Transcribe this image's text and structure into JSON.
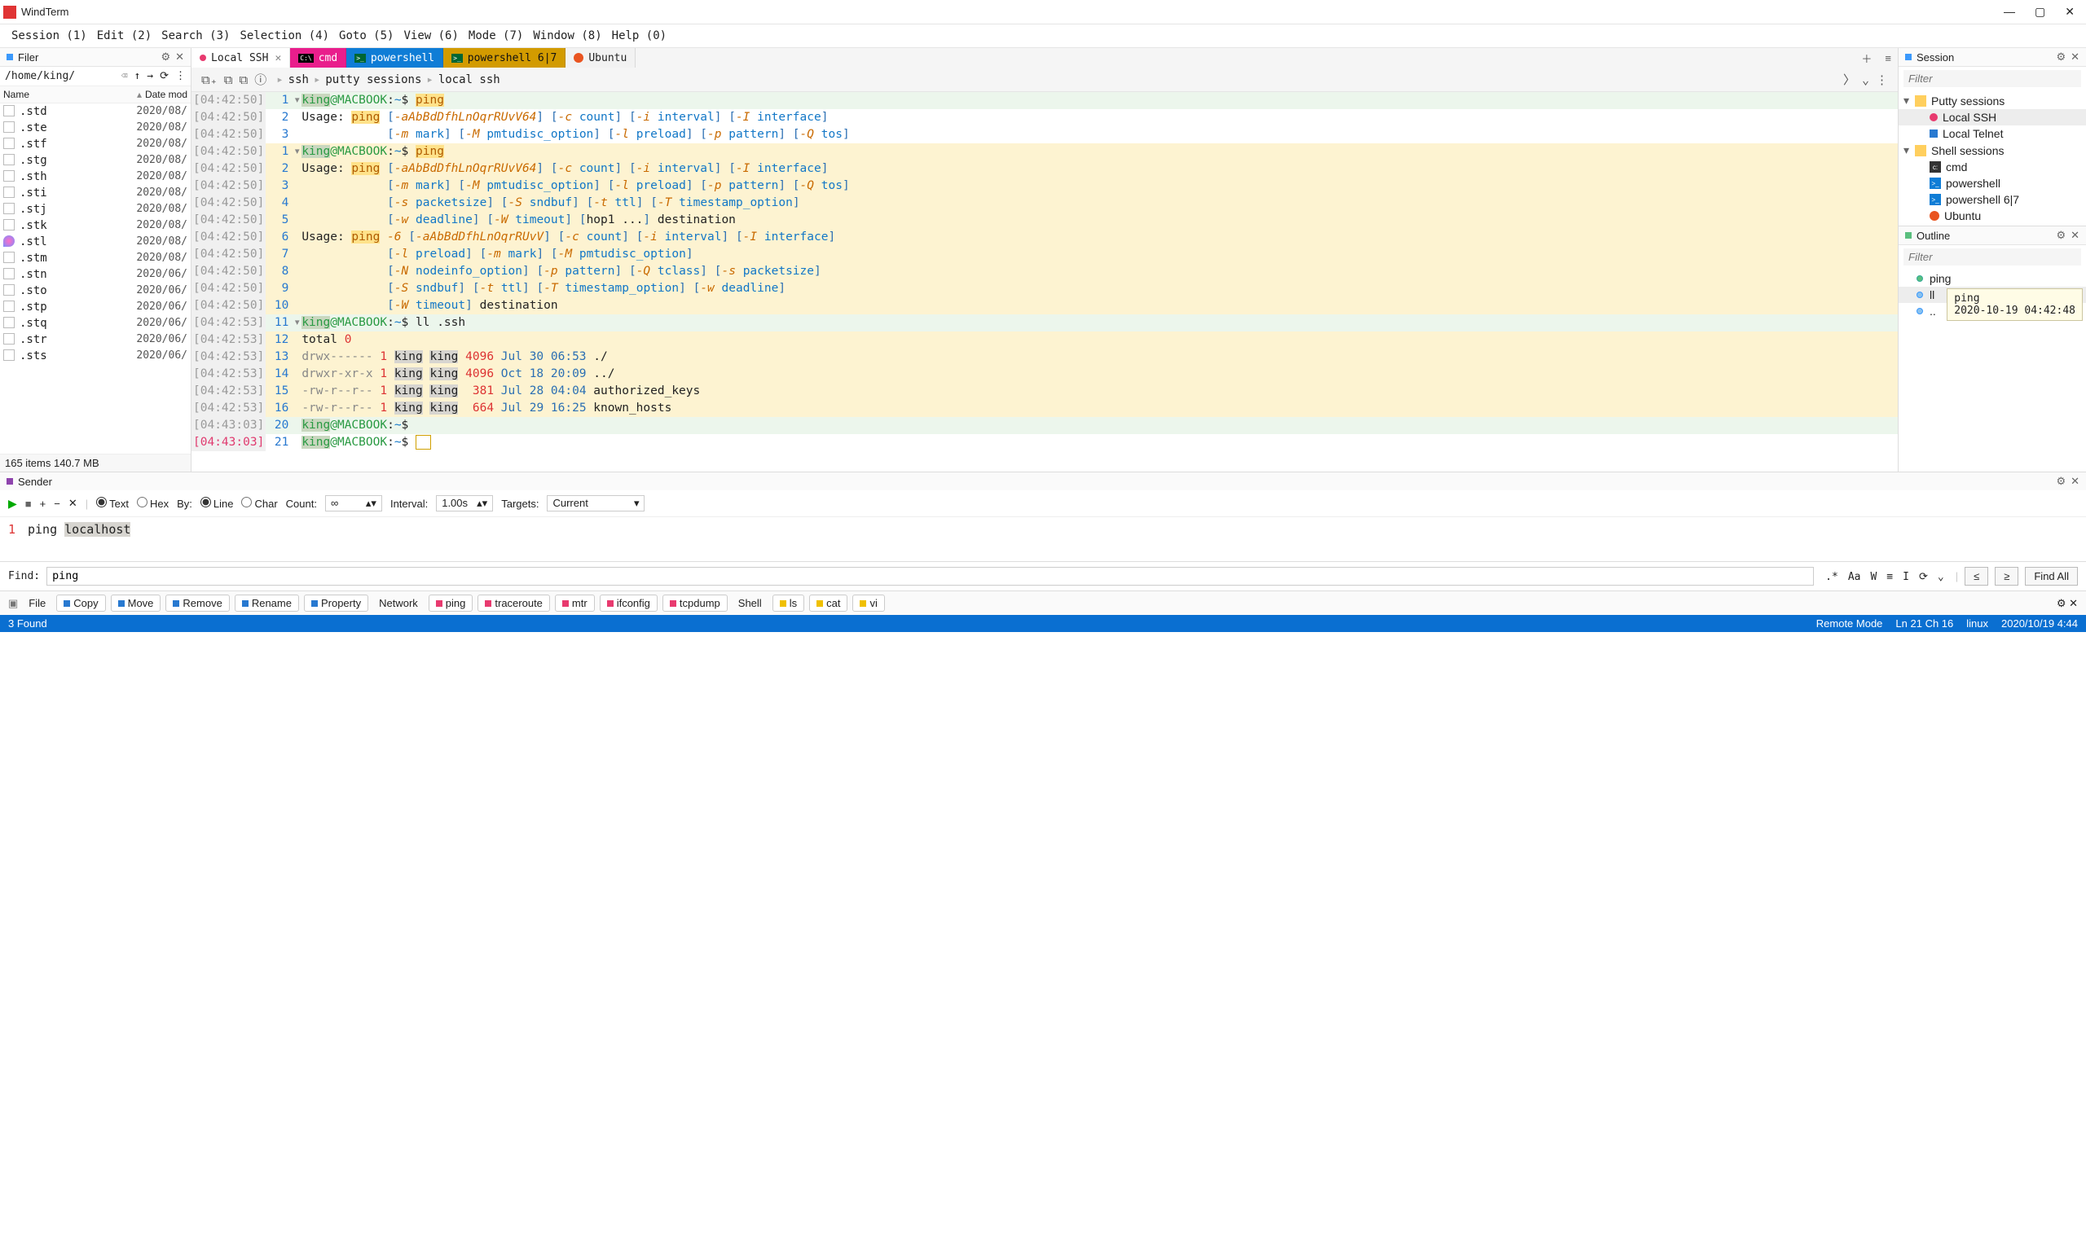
{
  "title": "WindTerm",
  "menu": [
    "Session (1)",
    "Edit (2)",
    "Search (3)",
    "Selection (4)",
    "Goto (5)",
    "View (6)",
    "Mode (7)",
    "Window (8)",
    "Help (0)"
  ],
  "filer": {
    "title": "Filer",
    "path": "/home/king/",
    "cols": [
      "Name",
      "Date mod"
    ],
    "items": [
      {
        "name": ".std",
        "date": "2020/08/"
      },
      {
        "name": ".ste",
        "date": "2020/08/"
      },
      {
        "name": ".stf",
        "date": "2020/08/"
      },
      {
        "name": ".stg",
        "date": "2020/08/"
      },
      {
        "name": ".sth",
        "date": "2020/08/"
      },
      {
        "name": ".sti",
        "date": "2020/08/"
      },
      {
        "name": ".stj",
        "date": "2020/08/"
      },
      {
        "name": ".stk",
        "date": "2020/08/"
      },
      {
        "name": ".stl",
        "date": "2020/08/",
        "balloon": true
      },
      {
        "name": ".stm",
        "date": "2020/08/"
      },
      {
        "name": ".stn",
        "date": "2020/06/"
      },
      {
        "name": ".sto",
        "date": "2020/06/"
      },
      {
        "name": ".stp",
        "date": "2020/06/"
      },
      {
        "name": ".stq",
        "date": "2020/06/"
      },
      {
        "name": ".str",
        "date": "2020/06/"
      },
      {
        "name": ".sts",
        "date": "2020/06/"
      }
    ],
    "footer": "165 items 140.7 MB"
  },
  "tabs": [
    {
      "label": "Local SSH",
      "cls": "local",
      "dot": "#e83a6f",
      "close": true
    },
    {
      "label": "cmd",
      "cls": "cmd",
      "icon": "cmd"
    },
    {
      "label": "powershell",
      "cls": "ps1",
      "icon": "ps"
    },
    {
      "label": "powershell 6|7",
      "cls": "ps2",
      "icon": "ps"
    },
    {
      "label": "Ubuntu",
      "cls": "ubu",
      "icon": "ubu"
    }
  ],
  "breadcrumb": [
    "ssh",
    "putty sessions",
    "local ssh"
  ],
  "session": {
    "title": "Session",
    "filter": "Filter",
    "groups": [
      {
        "label": "Putty sessions",
        "items": [
          {
            "label": "Local SSH",
            "ico": "red",
            "selected": true
          },
          {
            "label": "Local Telnet",
            "ico": "blue"
          }
        ]
      },
      {
        "label": "Shell sessions",
        "items": [
          {
            "label": "cmd",
            "ico": "cmd"
          },
          {
            "label": "powershell",
            "ico": "ps"
          },
          {
            "label": "powershell 6|7",
            "ico": "ps"
          },
          {
            "label": "Ubuntu",
            "ico": "ubu"
          }
        ]
      }
    ]
  },
  "outline": {
    "title": "Outline",
    "filter": "Filter",
    "items": [
      {
        "label": "ping",
        "cls": "green"
      },
      {
        "label": "ll",
        "cls": "blue",
        "sel": true
      },
      {
        "label": "..",
        "cls": "blue"
      }
    ],
    "tooltip": {
      "l1": "ping",
      "l2": "2020-10-19 04:42:48"
    }
  },
  "sender": {
    "title": "Sender",
    "textLabel": "Text",
    "hexLabel": "Hex",
    "byLabel": "By:",
    "lineLabel": "Line",
    "charLabel": "Char",
    "countLabel": "Count:",
    "countVal": "∞",
    "intervalLabel": "Interval:",
    "intervalVal": "1.00s",
    "targetsLabel": "Targets:",
    "targetsVal": "Current",
    "line_no": "1",
    "cmd_pre": "ping ",
    "cmd_sel": "localhost"
  },
  "find": {
    "label": "Find:",
    "value": "ping",
    "opts": [
      ".*",
      "Aa",
      "W",
      "≡",
      "I",
      "⟳",
      "⌄"
    ],
    "nav": [
      "≤",
      "≥"
    ],
    "btn": "Find All"
  },
  "toolbar2": {
    "file": "File",
    "ops": [
      {
        "l": "Copy",
        "c": "#2879d0"
      },
      {
        "l": "Move",
        "c": "#2879d0"
      },
      {
        "l": "Remove",
        "c": "#2879d0"
      },
      {
        "l": "Rename",
        "c": "#2879d0"
      },
      {
        "l": "Property",
        "c": "#2879d0"
      }
    ],
    "network": "Network",
    "net": [
      {
        "l": "ping",
        "c": "#e83a6f"
      },
      {
        "l": "traceroute",
        "c": "#e83a6f"
      },
      {
        "l": "mtr",
        "c": "#e83a6f"
      },
      {
        "l": "ifconfig",
        "c": "#e83a6f"
      },
      {
        "l": "tcpdump",
        "c": "#e83a6f"
      }
    ],
    "shell": "Shell",
    "sh": [
      {
        "l": "ls",
        "c": "#f0c000"
      },
      {
        "l": "cat",
        "c": "#f0c000"
      },
      {
        "l": "vi",
        "c": "#f0c000"
      }
    ]
  },
  "status": {
    "found": "3 Found",
    "mode": "Remote Mode",
    "pos": "Ln 21 Ch 16",
    "os": "linux",
    "date": "2020/10/19 4:44"
  },
  "terminal_lines": [
    {
      "ts": "[04:42:50]",
      "ln": "1",
      "bg": "bg-green",
      "fold": true,
      "html": "<span class='hl-prompt-user hl-prompt-user-bg'>king</span><span class='hl-green'>@MACBOOK</span>:<span class='hl-arg'>~</span>$ <span class='hl-ping'>ping</span>"
    },
    {
      "ts": "[04:42:50]",
      "ln": "2",
      "bg": "",
      "html": "Usage: <span class='hl-ping'>ping</span> <span class='hl-br'>[</span><span class='hl-opt'>-aAbBdDfhLnOqrRUvV64</span><span class='hl-br'>]</span> <span class='hl-br'>[</span><span class='hl-opt'>-c</span> <span class='hl-arg'>count</span><span class='hl-br'>]</span> <span class='hl-br'>[</span><span class='hl-opt'>-i</span> <span class='hl-arg'>interval</span><span class='hl-br'>]</span> <span class='hl-br'>[</span><span class='hl-opt'>-I</span> <span class='hl-arg'>interface</span><span class='hl-br'>]</span>"
    },
    {
      "ts": "[04:42:50]",
      "ln": "3",
      "bg": "",
      "html": "            <span class='hl-br'>[</span><span class='hl-opt'>-m</span> <span class='hl-arg'>mark</span><span class='hl-br'>]</span> <span class='hl-br'>[</span><span class='hl-opt'>-M</span> <span class='hl-arg'>pmtudisc_option</span><span class='hl-br'>]</span> <span class='hl-br'>[</span><span class='hl-opt'>-l</span> <span class='hl-arg'>preload</span><span class='hl-br'>]</span> <span class='hl-br'>[</span><span class='hl-opt'>-p</span> <span class='hl-arg'>pattern</span><span class='hl-br'>]</span> <span class='hl-br'>[</span><span class='hl-opt'>-Q</span> <span class='hl-arg'>tos</span><span class='hl-br'>]</span>"
    },
    {
      "ts": "[04:42:50]",
      "ln": "1",
      "bg": "bg-yellow",
      "fold": true,
      "html": "<span class='hl-prompt-user hl-prompt-user-bg'>king</span><span class='hl-green'>@MACBOOK</span>:<span class='hl-arg'>~</span>$ <span class='hl-ping'>ping</span>"
    },
    {
      "ts": "[04:42:50]",
      "ln": "2",
      "bg": "bg-yellow",
      "html": "Usage: <span class='hl-ping'>ping</span> <span class='hl-br'>[</span><span class='hl-opt'>-aAbBdDfhLnOqrRUvV64</span><span class='hl-br'>]</span> <span class='hl-br'>[</span><span class='hl-opt'>-c</span> <span class='hl-arg'>count</span><span class='hl-br'>]</span> <span class='hl-br'>[</span><span class='hl-opt'>-i</span> <span class='hl-arg'>interval</span><span class='hl-br'>]</span> <span class='hl-br'>[</span><span class='hl-opt'>-I</span> <span class='hl-arg'>interface</span><span class='hl-br'>]</span>"
    },
    {
      "ts": "[04:42:50]",
      "ln": "3",
      "bg": "bg-yellow",
      "html": "            <span class='hl-br'>[</span><span class='hl-opt'>-m</span> <span class='hl-arg'>mark</span><span class='hl-br'>]</span> <span class='hl-br'>[</span><span class='hl-opt'>-M</span> <span class='hl-arg'>pmtudisc_option</span><span class='hl-br'>]</span> <span class='hl-br'>[</span><span class='hl-opt'>-l</span> <span class='hl-arg'>preload</span><span class='hl-br'>]</span> <span class='hl-br'>[</span><span class='hl-opt'>-p</span> <span class='hl-arg'>pattern</span><span class='hl-br'>]</span> <span class='hl-br'>[</span><span class='hl-opt'>-Q</span> <span class='hl-arg'>tos</span><span class='hl-br'>]</span>"
    },
    {
      "ts": "[04:42:50]",
      "ln": "4",
      "bg": "bg-yellow",
      "html": "            <span class='hl-br'>[</span><span class='hl-opt'>-s</span> <span class='hl-arg'>packetsize</span><span class='hl-br'>]</span> <span class='hl-br'>[</span><span class='hl-opt'>-S</span> <span class='hl-arg'>sndbuf</span><span class='hl-br'>]</span> <span class='hl-br'>[</span><span class='hl-opt'>-t</span> <span class='hl-arg'>ttl</span><span class='hl-br'>]</span> <span class='hl-br'>[</span><span class='hl-opt'>-T</span> <span class='hl-arg'>timestamp_option</span><span class='hl-br'>]</span>"
    },
    {
      "ts": "[04:42:50]",
      "ln": "5",
      "bg": "bg-yellow",
      "html": "            <span class='hl-br'>[</span><span class='hl-opt'>-w</span> <span class='hl-arg'>deadline</span><span class='hl-br'>]</span> <span class='hl-br'>[</span><span class='hl-opt'>-W</span> <span class='hl-arg'>timeout</span><span class='hl-br'>]</span> <span class='hl-br'>[</span>hop1 ...<span class='hl-br'>]</span> destination"
    },
    {
      "ts": "[04:42:50]",
      "ln": "6",
      "bg": "bg-yellow",
      "html": "Usage: <span class='hl-ping'>ping</span> <span class='hl-opt'>-6</span> <span class='hl-br'>[</span><span class='hl-opt'>-aAbBdDfhLnOqrRUvV</span><span class='hl-br'>]</span> <span class='hl-br'>[</span><span class='hl-opt'>-c</span> <span class='hl-arg'>count</span><span class='hl-br'>]</span> <span class='hl-br'>[</span><span class='hl-opt'>-i</span> <span class='hl-arg'>interval</span><span class='hl-br'>]</span> <span class='hl-br'>[</span><span class='hl-opt'>-I</span> <span class='hl-arg'>interface</span><span class='hl-br'>]</span>"
    },
    {
      "ts": "[04:42:50]",
      "ln": "7",
      "bg": "bg-yellow",
      "html": "            <span class='hl-br'>[</span><span class='hl-opt'>-l</span> <span class='hl-arg'>preload</span><span class='hl-br'>]</span> <span class='hl-br'>[</span><span class='hl-opt'>-m</span> <span class='hl-arg'>mark</span><span class='hl-br'>]</span> <span class='hl-br'>[</span><span class='hl-opt'>-M</span> <span class='hl-arg'>pmtudisc_option</span><span class='hl-br'>]</span>"
    },
    {
      "ts": "[04:42:50]",
      "ln": "8",
      "bg": "bg-yellow",
      "html": "            <span class='hl-br'>[</span><span class='hl-opt'>-N</span> <span class='hl-arg'>nodeinfo_option</span><span class='hl-br'>]</span> <span class='hl-br'>[</span><span class='hl-opt'>-p</span> <span class='hl-arg'>pattern</span><span class='hl-br'>]</span> <span class='hl-br'>[</span><span class='hl-opt'>-Q</span> <span class='hl-arg'>tclass</span><span class='hl-br'>]</span> <span class='hl-br'>[</span><span class='hl-opt'>-s</span> <span class='hl-arg'>packetsize</span><span class='hl-br'>]</span>"
    },
    {
      "ts": "[04:42:50]",
      "ln": "9",
      "bg": "bg-yellow",
      "html": "            <span class='hl-br'>[</span><span class='hl-opt'>-S</span> <span class='hl-arg'>sndbuf</span><span class='hl-br'>]</span> <span class='hl-br'>[</span><span class='hl-opt'>-t</span> <span class='hl-arg'>ttl</span><span class='hl-br'>]</span> <span class='hl-br'>[</span><span class='hl-opt'>-T</span> <span class='hl-arg'>timestamp_option</span><span class='hl-br'>]</span> <span class='hl-br'>[</span><span class='hl-opt'>-w</span> <span class='hl-arg'>deadline</span><span class='hl-br'>]</span>"
    },
    {
      "ts": "[04:42:50]",
      "ln": "10",
      "bg": "bg-yellow",
      "html": "            <span class='hl-br'>[</span><span class='hl-opt'>-W</span> <span class='hl-arg'>timeout</span><span class='hl-br'>]</span> destination"
    },
    {
      "ts": "[04:42:53]",
      "ln": "11",
      "bg": "bg-green",
      "fold": true,
      "html": "<span class='hl-prompt-user hl-prompt-user-bg'>king</span><span class='hl-green'>@MACBOOK</span>:<span class='hl-arg'>~</span>$ ll .ssh"
    },
    {
      "ts": "[04:42:53]",
      "ln": "12",
      "bg": "bg-yellow",
      "html": "total <span class='hl-num'>0</span>"
    },
    {
      "ts": "[04:42:53]",
      "ln": "13",
      "bg": "bg-yellow",
      "html": "<span class='hl-gray'>drwx------ </span><span class='hl-num'>1</span> <span class='hl-kingbg'>king</span> <span class='hl-kingbg'>king</span> <span class='hl-num'>4096</span> <span class='hl-date'>Jul 30 06:53</span> ./"
    },
    {
      "ts": "[04:42:53]",
      "ln": "14",
      "bg": "bg-yellow",
      "html": "<span class='hl-gray'>drwxr-xr-x </span><span class='hl-num'>1</span> <span class='hl-kingbg'>king</span> <span class='hl-kingbg'>king</span> <span class='hl-num'>4096</span> <span class='hl-date'>Oct 18 20:09</span> ../"
    },
    {
      "ts": "[04:42:53]",
      "ln": "15",
      "bg": "bg-yellow",
      "html": "<span class='hl-gray'>-rw-r--r-- </span><span class='hl-num'>1</span> <span class='hl-kingbg'>king</span> <span class='hl-kingbg'>king</span>  <span class='hl-num'>381</span> <span class='hl-date'>Jul 28 04:04</span> authorized_keys"
    },
    {
      "ts": "[04:42:53]",
      "ln": "16",
      "bg": "bg-yellow",
      "html": "<span class='hl-gray'>-rw-r--r-- </span><span class='hl-num'>1</span> <span class='hl-kingbg'>king</span> <span class='hl-kingbg'>king</span>  <span class='hl-num'>664</span> <span class='hl-date'>Jul 29 16:25</span> known_hosts"
    },
    {
      "ts": "[04:43:03]",
      "ln": "20",
      "bg": "bg-green",
      "html": "<span class='hl-prompt-user hl-prompt-user-bg'>king</span><span class='hl-green'>@MACBOOK</span>:<span class='hl-arg'>~</span>$"
    },
    {
      "ts": "[04:43:03]",
      "ln": "21",
      "bg": "",
      "ts_red": true,
      "html": "<span class='hl-prompt-user hl-prompt-user-bg'>king</span><span class='hl-green'>@MACBOOK</span>:<span class='hl-arg'>~</span>$ <span style='border:1px solid #d0a000;padding:0 4px'>&nbsp;</span>"
    }
  ]
}
